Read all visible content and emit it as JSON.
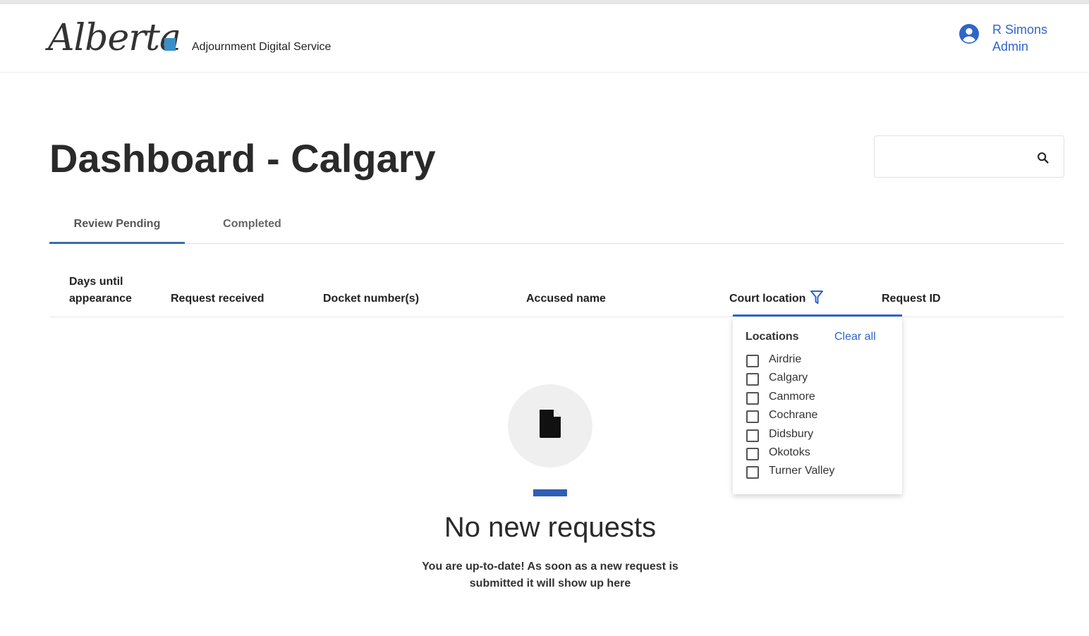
{
  "header": {
    "logo_text": "Alberta",
    "app_name": "Adjournment Digital Service",
    "user": {
      "name": "R Simons",
      "role": "Admin"
    }
  },
  "page": {
    "title": "Dashboard - Calgary",
    "search": {
      "placeholder": "",
      "value": ""
    }
  },
  "tabs": [
    {
      "label": "Review Pending",
      "active": true
    },
    {
      "label": "Completed",
      "active": false
    }
  ],
  "table": {
    "columns": {
      "days": "Days until appearance",
      "received": "Request received",
      "docket": "Docket number(s)",
      "accused": "Accused name",
      "court": "Court location",
      "request_id": "Request ID"
    }
  },
  "filter_dropdown": {
    "title": "Locations",
    "clear_label": "Clear all",
    "options": [
      "Airdrie",
      "Calgary",
      "Canmore",
      "Cochrane",
      "Didsbury",
      "Okotoks",
      "Turner Valley"
    ]
  },
  "empty_state": {
    "title": "No new requests",
    "message": "You are up-to-date! As soon as a new request is submitted it will show up here"
  },
  "colors": {
    "link_blue": "#2f66c8",
    "tab_underline": "#3a6da8",
    "empty_bar": "#2f5fb3"
  }
}
